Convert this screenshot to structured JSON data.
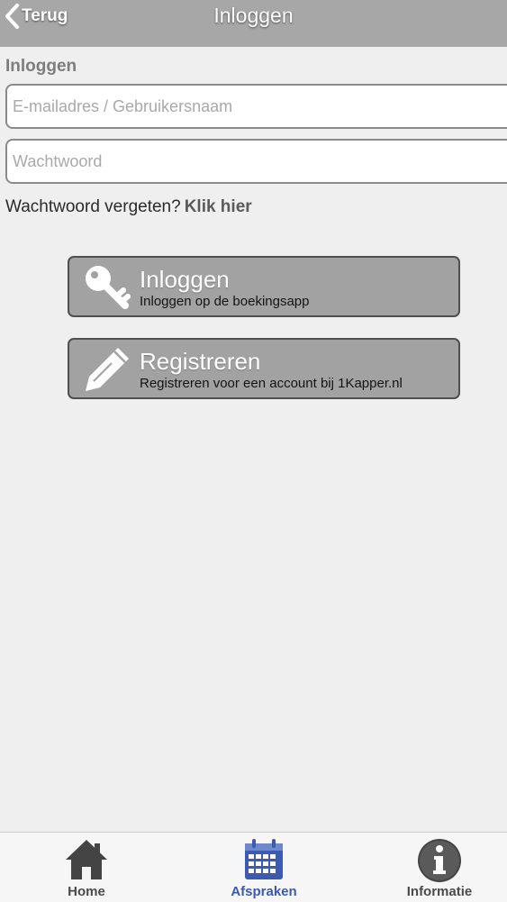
{
  "header": {
    "back_label": "Terug",
    "title": "Inloggen"
  },
  "form": {
    "section_label": "Inloggen",
    "email_placeholder": "E-mailadres / Gebruikersnaam",
    "email_value": "",
    "password_placeholder": "Wachtwoord",
    "password_value": "",
    "forgot_text": "Wachtwoord vergeten?",
    "forgot_link": "Klik hier"
  },
  "actions": [
    {
      "title": "Inloggen",
      "subtitle": "Inloggen op de boekingsapp",
      "icon": "key-icon"
    },
    {
      "title": "Registreren",
      "subtitle": "Registreren voor een account bij 1Kapper.nl",
      "icon": "pencil-icon"
    }
  ],
  "tabbar": {
    "items": [
      {
        "label": "Home",
        "icon": "home-icon",
        "active": false
      },
      {
        "label": "Afspraken",
        "icon": "calendar-icon",
        "active": true
      },
      {
        "label": "Informatie",
        "icon": "info-icon",
        "active": false
      }
    ]
  },
  "colors": {
    "header_bg": "#a7a7a7",
    "button_bg": "#a2a2a2",
    "active_tab": "#3b5bb0",
    "page_bg": "#efeff0"
  }
}
